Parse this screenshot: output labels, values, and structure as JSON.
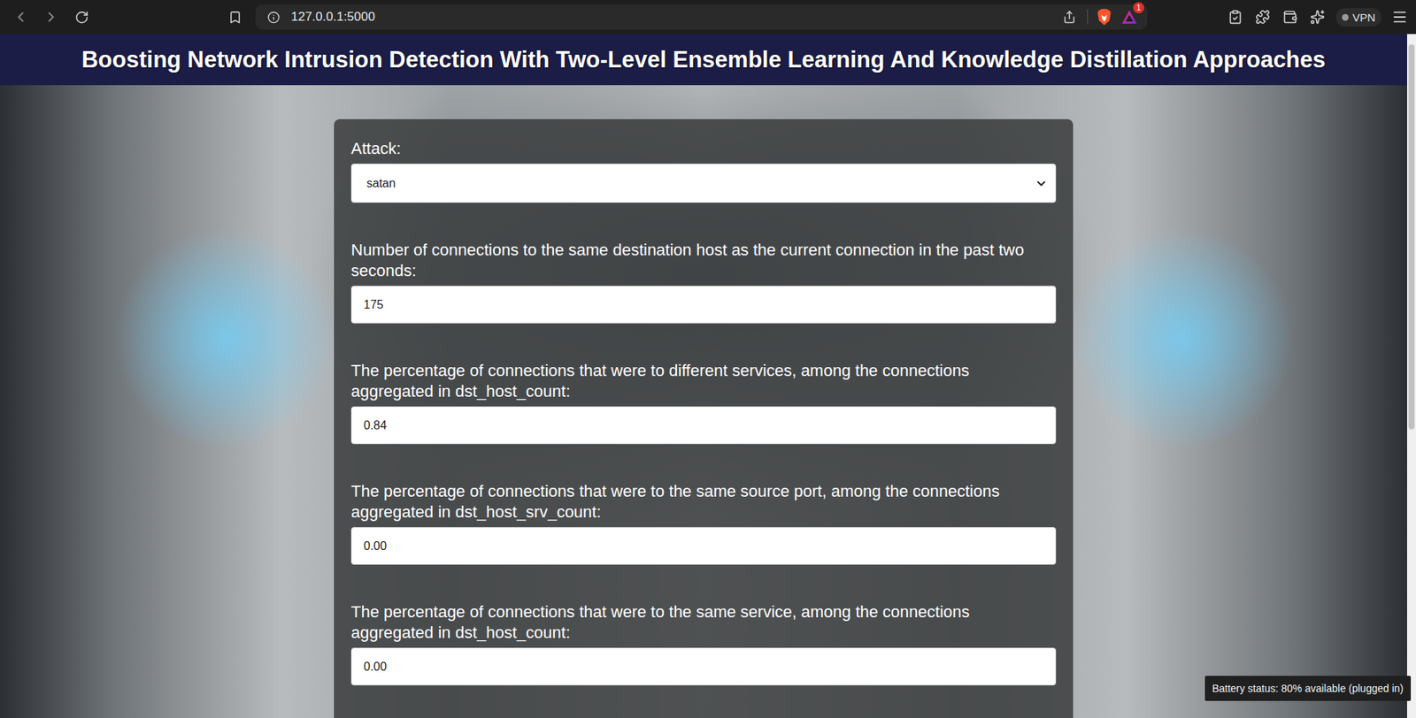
{
  "browser": {
    "url": "127.0.0.1:5000",
    "badge": "1",
    "vpn": "VPN"
  },
  "header": {
    "title": "Boosting Network Intrusion Detection With Two-Level Ensemble Learning And Knowledge Distillation Approaches"
  },
  "form": {
    "fields": [
      {
        "kind": "select",
        "label": "Attack:",
        "value": "satan"
      },
      {
        "kind": "input",
        "label": "Number of connections to the same destination host as the current connection in the past two seconds:",
        "value": "175"
      },
      {
        "kind": "input",
        "label": "The percentage of connections that were to different services, among the connections aggregated in dst_host_count:",
        "value": "0.84"
      },
      {
        "kind": "input",
        "label": "The percentage of connections that were to the same source port, among the connections aggregated in dst_host_srv_count:",
        "value": "0.00"
      },
      {
        "kind": "input",
        "label": "The percentage of connections that were to the same service, among the connections aggregated in dst_host_count:",
        "value": "0.00"
      }
    ]
  },
  "status_tooltip": {
    "text": "Battery status: 80% available (plugged in)"
  }
}
